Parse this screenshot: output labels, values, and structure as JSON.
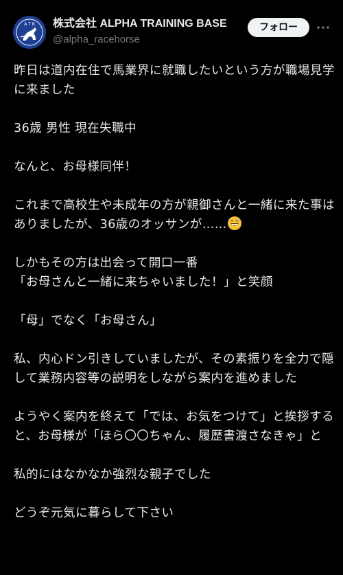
{
  "account": {
    "display_name": "株式会社 ALPHA TRAINING BASE",
    "handle": "@alpha_racehorse",
    "avatar_text": "A T B"
  },
  "actions": {
    "follow_label": "フォロー",
    "more_icon": "more-horizontal-icon"
  },
  "post": {
    "paragraphs": [
      "昨日は道内在住で馬業界に就職したいという方が職場見学に来ました",
      "36歳 男性 現在失職中",
      "なんと、お母様同伴！",
      "これまで高校生や未成年の方が親御さんと一緒に来た事はありましたが、36歳のオッサンが……",
      "しかもその方は出会って開口一番\n「お母さんと一緒に来ちゃいました！」と笑顔",
      "「母」でなく「お母さん」",
      "私、内心ドン引きしていましたが、その素振りを全力で隠して業務内容等の説明をしながら案内を進めました",
      "ようやく案内を終えて「では、お気をつけて」と挨拶すると、お母様が「ほら〇〇ちゃん、履歴書渡さなきゃ」と",
      "私的にはなかなか強烈な親子でした",
      "どうぞ元気に暮らして下さい"
    ],
    "emoji": "grinning-face-with-sweat-icon"
  },
  "colors": {
    "background": "#000000",
    "text": "#e7e9ea",
    "secondary": "#71767b",
    "follow_bg": "#eff3f4",
    "avatar_bg": "#1d3f94"
  }
}
